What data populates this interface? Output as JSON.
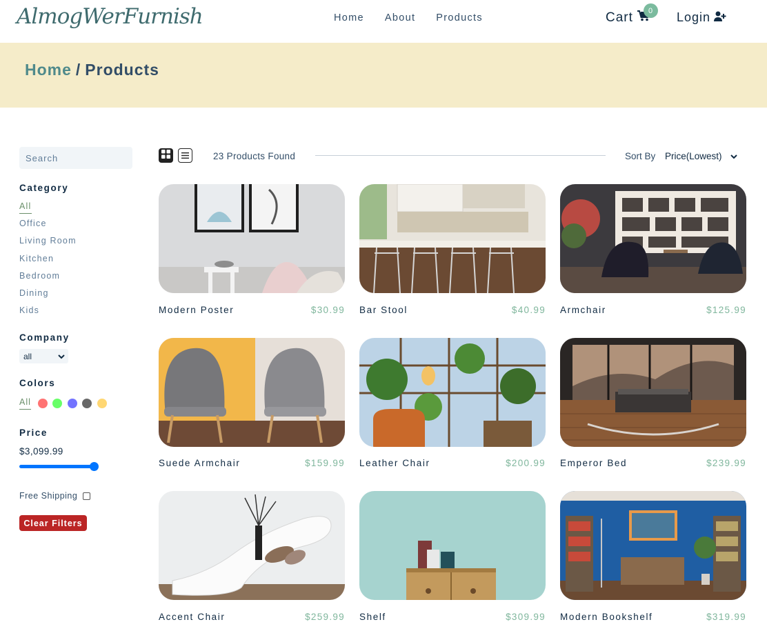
{
  "navbar": {
    "logo_text": "AlmogWerFurnish",
    "links": [
      "Home",
      "About",
      "Products"
    ],
    "cart_label": "Cart",
    "cart_count": "0",
    "login_label": "Login"
  },
  "breadcrumb": {
    "home": "Home",
    "separator": "/",
    "current": "Products"
  },
  "filters": {
    "search_placeholder": "Search",
    "category_heading": "Category",
    "categories": [
      "All",
      "Office",
      "Living Room",
      "Kitchen",
      "Bedroom",
      "Dining",
      "Kids"
    ],
    "company_heading": "Company",
    "company_selected": "all",
    "colors_heading": "Colors",
    "colors_all": "All",
    "colors": [
      "#ff5a5a",
      "#4dff4d",
      "#5a5aff",
      "#4d4d4d",
      "#ffd05a"
    ],
    "price_heading": "Price",
    "price_value": "$3,099.99",
    "price_level": 1.0,
    "free_shipping_label": "Free Shipping",
    "free_shipping_checked": false,
    "clear_label": "Clear Filters"
  },
  "sort": {
    "products_found": "23 Products Found",
    "sort_label": "Sort By",
    "sort_selected": "Price(Lowest)",
    "view_modes": [
      "grid-icon",
      "list-icon"
    ]
  },
  "products": [
    {
      "name": "Modern Poster",
      "price": "$30.99"
    },
    {
      "name": "Bar Stool",
      "price": "$40.99"
    },
    {
      "name": "Armchair",
      "price": "$125.99"
    },
    {
      "name": "Suede Armchair",
      "price": "$159.99"
    },
    {
      "name": "Leather Chair",
      "price": "$200.99"
    },
    {
      "name": "Emperor Bed",
      "price": "$239.99"
    },
    {
      "name": "Accent Chair",
      "price": "$259.99"
    },
    {
      "name": "Shelf",
      "price": "$309.99"
    },
    {
      "name": "Modern Bookshelf",
      "price": "$319.99"
    }
  ],
  "colors": {
    "accent": "#7fb69c",
    "hero_bg": "#f5ecc9",
    "clear_button": "#bb2525",
    "breadcrumb_home": "#4f8a8b"
  }
}
